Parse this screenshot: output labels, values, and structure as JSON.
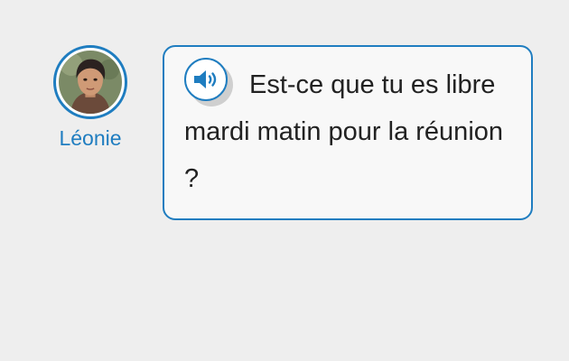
{
  "speaker": {
    "name": "Léonie",
    "avatar_icon": "person-portrait-icon"
  },
  "message": {
    "text": "Est-ce que tu es libre mardi matin pour la réunion ?",
    "audio_icon": "speaker-volume-icon"
  },
  "colors": {
    "accent": "#1f7dc0",
    "background": "#eeeeee",
    "bubble": "#f8f8f8",
    "text": "#222222"
  }
}
